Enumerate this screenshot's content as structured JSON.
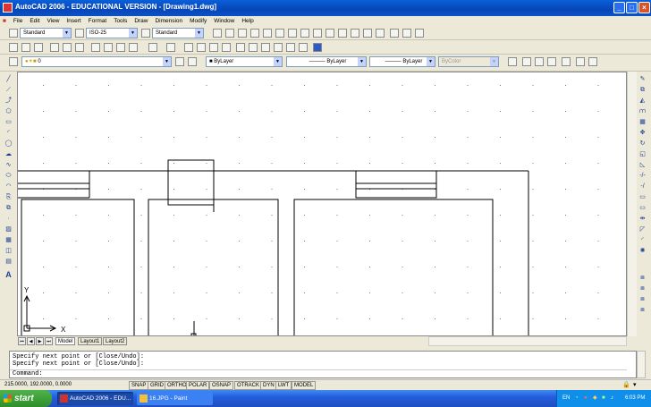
{
  "window": {
    "title": "AutoCAD 2006 - EDUCATIONAL VERSION - [Drawing1.dwg]"
  },
  "menu": [
    "File",
    "Edit",
    "View",
    "Insert",
    "Format",
    "Tools",
    "Draw",
    "Dimension",
    "Modify",
    "Window",
    "Help"
  ],
  "styles_toolbar": {
    "text_style": "Standard",
    "dim_style": "ISO-25",
    "table_style": "Standard"
  },
  "layers_toolbar": {
    "layer": "0",
    "color": "ByLayer",
    "linetype": "ByLayer",
    "lineweight": "ByLayer",
    "plotstyle": "ByColor"
  },
  "ucs": {
    "y_label": "Y",
    "x_label": "X"
  },
  "tabs": [
    "Model",
    "Layout1",
    "Layout2"
  ],
  "command_line": {
    "history": [
      "Specify next point or [Close/Undo]:",
      "Specify next point or [Close/Undo]:"
    ],
    "prompt": "Command:"
  },
  "status": {
    "coordinates": "215.0000, 192.0000, 0.0000",
    "toggles": [
      "SNAP",
      "GRID",
      "ORTHO",
      "POLAR",
      "OSNAP",
      "OTRACK",
      "DYN",
      "LWT",
      "MODEL"
    ]
  },
  "taskbar": {
    "start": "start",
    "tasks": [
      "AutoCAD 2006 - EDU...",
      "16.JPG - Paint"
    ],
    "language": "EN",
    "clock": "6:03 PM"
  }
}
